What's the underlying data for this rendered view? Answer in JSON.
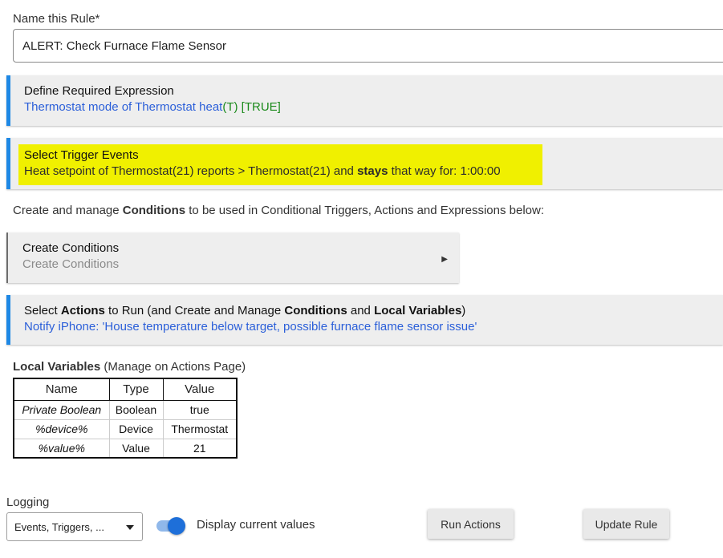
{
  "name_rule": {
    "label": "Name this Rule*",
    "value": "ALERT: Check Furnace Flame Sensor"
  },
  "expression": {
    "title": "Define Required Expression",
    "detail_blue": "Thermostat mode of Thermostat heat",
    "detail_green": "(T) [TRUE]"
  },
  "trigger": {
    "title": "Select Trigger Events",
    "detail_before": "Heat setpoint of Thermostat(21) reports > Thermostat(21) and ",
    "detail_bold": "stays",
    "detail_after": " that way for: 1:00:00"
  },
  "conditions_intro": {
    "before": "Create and manage ",
    "bold": "Conditions",
    "after": " to be used in Conditional Triggers, Actions and Expressions below:"
  },
  "create_conditions": {
    "title": "Create Conditions",
    "subtitle": "Create Conditions",
    "arrow": "▶"
  },
  "actions": {
    "t1": "Select ",
    "b1": "Actions",
    "t2": " to Run (and Create and Manage ",
    "b2": "Conditions",
    "t3": " and ",
    "b3": "Local Variables",
    "t4": ")",
    "detail": "Notify iPhone: 'House temperature below target, possible furnace flame sensor issue'"
  },
  "local_vars": {
    "heading_bold": "Local Variables",
    "heading_rest": " (Manage on Actions Page)",
    "columns": [
      "Name",
      "Type",
      "Value"
    ],
    "rows": [
      [
        "Private Boolean",
        "Boolean",
        "true"
      ],
      [
        "%device%",
        "Device",
        "Thermostat"
      ],
      [
        "%value%",
        "Value",
        "21"
      ]
    ]
  },
  "logging": {
    "label": "Logging",
    "selected": "Events, Triggers, ..."
  },
  "display_toggle": {
    "label": "Display current values",
    "on": true
  },
  "buttons": {
    "run": "Run Actions",
    "update": "Update Rule"
  },
  "colors": {
    "accent_blue": "#1e88e5",
    "link_blue": "#2b5fd9",
    "true_green": "#1a8a1a",
    "highlight_yellow": "#f0f000"
  }
}
